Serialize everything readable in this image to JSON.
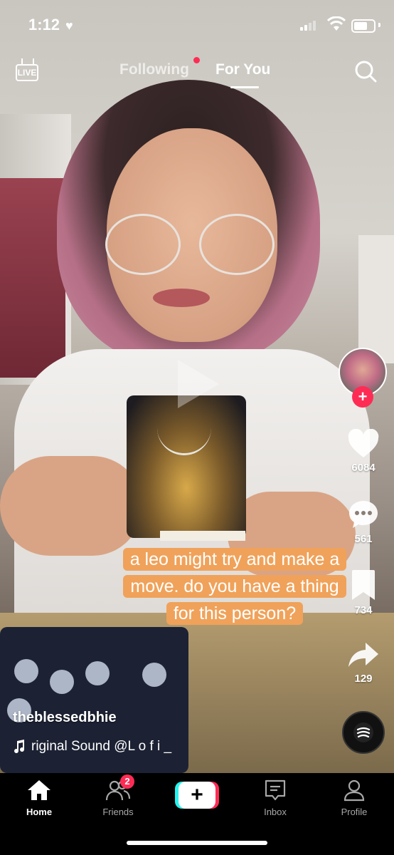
{
  "status_bar": {
    "time": "1:12"
  },
  "top_bar": {
    "live_label": "LIVE",
    "tabs": [
      {
        "label": "Following",
        "active": false,
        "has_dot": true
      },
      {
        "label": "For You",
        "active": true
      }
    ]
  },
  "actions": {
    "likes": "6084",
    "comments": "561",
    "saves": "734",
    "shares": "129",
    "follow_symbol": "+"
  },
  "caption": {
    "line1": "a leo might try and make a",
    "line2": "move. do you have a thing",
    "line3": "for this person?"
  },
  "post": {
    "username": "theblessedbhie",
    "sound": "riginal Sound     @L o f i _"
  },
  "bottom_nav": {
    "home": "Home",
    "friends": "Friends",
    "friends_badge": "2",
    "create_symbol": "+",
    "inbox": "Inbox",
    "profile": "Profile"
  },
  "colors": {
    "accent": "#fe2c55",
    "cyan": "#25f4ee",
    "caption_bg": "#f0a25a"
  }
}
